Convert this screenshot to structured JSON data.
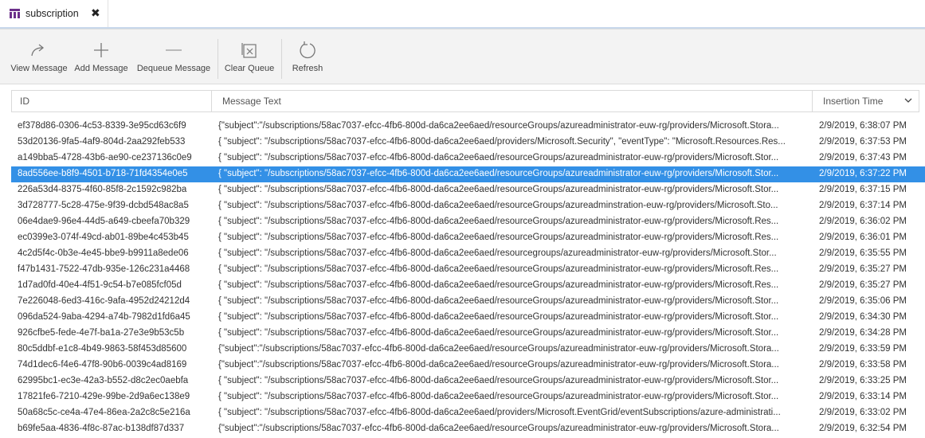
{
  "tab": {
    "title": "subscription",
    "close_glyph": "✖",
    "icon": "queue-icon",
    "icon_color": "#6b2f8a"
  },
  "toolbar": {
    "view_message": "View Message",
    "add_message": "Add Message",
    "dequeue_message": "Dequeue Message",
    "clear_queue": "Clear Queue",
    "refresh": "Refresh"
  },
  "columns": {
    "id": "ID",
    "message_text": "Message Text",
    "insertion_time": "Insertion Time"
  },
  "colors": {
    "selected_row": "#3390e6",
    "toolbar_bg": "#f3f3f3"
  },
  "rows": [
    {
      "id": "ef378d86-0306-4c53-8339-3e95cd63c6f9",
      "message": "{\"subject\":\"/subscriptions/58ac7037-efcc-4fb6-800d-da6ca2ee6aed/resourceGroups/azureadministrator-euw-rg/providers/Microsoft.Stora...",
      "time": "2/9/2019, 6:38:07 PM"
    },
    {
      "id": "53d20136-9fa5-4af9-804d-2aa292feb533",
      "message": "{ \"subject\": \"/subscriptions/58ac7037-efcc-4fb6-800d-da6ca2ee6aed/providers/Microsoft.Security\", \"eventType\": \"Microsoft.Resources.Res...",
      "time": "2/9/2019, 6:37:53 PM"
    },
    {
      "id": "a149bba5-4728-43b6-ae90-ce237136c0e9",
      "message": "{ \"subject\": \"/subscriptions/58ac7037-efcc-4fb6-800d-da6ca2ee6aed/resourceGroups/azureadministrator-euw-rg/providers/Microsoft.Stor...",
      "time": "2/9/2019, 6:37:43 PM"
    },
    {
      "id": "8ad556ee-b8f9-4501-b718-71fd4354e0e5",
      "message": "{ \"subject\": \"/subscriptions/58ac7037-efcc-4fb6-800d-da6ca2ee6aed/resourceGroups/azureadministrator-euw-rg/providers/Microsoft.Stor...",
      "time": "2/9/2019, 6:37:22 PM",
      "selected": true
    },
    {
      "id": "226a53d4-8375-4f60-85f8-2c1592c982ba",
      "message": "{ \"subject\": \"/subscriptions/58ac7037-efcc-4fb6-800d-da6ca2ee6aed/resourceGroups/azureadministrator-euw-rg/providers/Microsoft.Stor...",
      "time": "2/9/2019, 6:37:15 PM"
    },
    {
      "id": "3d728777-5c28-475e-9f39-dcbd548ac8a5",
      "message": "{ \"subject\": \"/subscriptions/58ac7037-efcc-4fb6-800d-da6ca2ee6aed/resourceGroups/azureadminstration-euw-rg/providers/Microsoft.Sto...",
      "time": "2/9/2019, 6:37:14 PM"
    },
    {
      "id": "06e4dae9-96e4-44d5-a649-cbeefa70b329",
      "message": "{ \"subject\": \"/subscriptions/58ac7037-efcc-4fb6-800d-da6ca2ee6aed/resourceGroups/azureadministrator-euw-rg/providers/Microsoft.Res...",
      "time": "2/9/2019, 6:36:02 PM"
    },
    {
      "id": "ec0399e3-074f-49cd-ab01-89be4c453b45",
      "message": "{ \"subject\": \"/subscriptions/58ac7037-efcc-4fb6-800d-da6ca2ee6aed/resourceGroups/azureadministrator-euw-rg/providers/Microsoft.Res...",
      "time": "2/9/2019, 6:36:01 PM"
    },
    {
      "id": "4c2d5f4c-0b3e-4e45-bbe9-b9911a8ede06",
      "message": "{ \"subject\": \"/subscriptions/58ac7037-efcc-4fb6-800d-da6ca2ee6aed/resourcegroups/azureadministrator-euw-rg/providers/Microsoft.Stor...",
      "time": "2/9/2019, 6:35:55 PM"
    },
    {
      "id": "f47b1431-7522-47db-935e-126c231a4468",
      "message": "{ \"subject\": \"/subscriptions/58ac7037-efcc-4fb6-800d-da6ca2ee6aed/resourceGroups/azureadministrator-euw-rg/providers/Microsoft.Res...",
      "time": "2/9/2019, 6:35:27 PM"
    },
    {
      "id": "1d7ad0fd-40e4-4f51-9c54-b7e085fcf05d",
      "message": "{ \"subject\": \"/subscriptions/58ac7037-efcc-4fb6-800d-da6ca2ee6aed/resourceGroups/azureadministrator-euw-rg/providers/Microsoft.Res...",
      "time": "2/9/2019, 6:35:27 PM"
    },
    {
      "id": "7e226048-6ed3-416c-9afa-4952d24212d4",
      "message": "{ \"subject\": \"/subscriptions/58ac7037-efcc-4fb6-800d-da6ca2ee6aed/resourceGroups/azureadministrator-euw-rg/providers/Microsoft.Stor...",
      "time": "2/9/2019, 6:35:06 PM"
    },
    {
      "id": "096da524-9aba-4294-a74b-7982d1fd6a45",
      "message": "{ \"subject\": \"/subscriptions/58ac7037-efcc-4fb6-800d-da6ca2ee6aed/resourceGroups/azureadministrator-euw-rg/providers/Microsoft.Stor...",
      "time": "2/9/2019, 6:34:30 PM"
    },
    {
      "id": "926cfbe5-fede-4e7f-ba1a-27e3e9b53c5b",
      "message": "{ \"subject\": \"/subscriptions/58ac7037-efcc-4fb6-800d-da6ca2ee6aed/resourceGroups/azureadministrator-euw-rg/providers/Microsoft.Stor...",
      "time": "2/9/2019, 6:34:28 PM"
    },
    {
      "id": "80c5ddbf-e1c8-4b49-9863-58f453d85600",
      "message": "{\"subject\":\"/subscriptions/58ac7037-efcc-4fb6-800d-da6ca2ee6aed/resourceGroups/azureadministrator-euw-rg/providers/Microsoft.Stora...",
      "time": "2/9/2019, 6:33:59 PM"
    },
    {
      "id": "74d1dec6-f4e6-47f8-90b6-0039c4ad8169",
      "message": "{\"subject\":\"/subscriptions/58ac7037-efcc-4fb6-800d-da6ca2ee6aed/resourceGroups/azureadministrator-euw-rg/providers/Microsoft.Stora...",
      "time": "2/9/2019, 6:33:58 PM"
    },
    {
      "id": "62995bc1-ec3e-42a3-b552-d8c2ec0aebfa",
      "message": "{ \"subject\": \"/subscriptions/58ac7037-efcc-4fb6-800d-da6ca2ee6aed/resourceGroups/azureadministrator-euw-rg/providers/Microsoft.Stor...",
      "time": "2/9/2019, 6:33:25 PM"
    },
    {
      "id": "17821fe6-7210-429e-99be-2d9a6ec138e9",
      "message": "{ \"subject\": \"/subscriptions/58ac7037-efcc-4fb6-800d-da6ca2ee6aed/resourceGroups/azureadministrator-euw-rg/providers/Microsoft.Stor...",
      "time": "2/9/2019, 6:33:14 PM"
    },
    {
      "id": "50a68c5c-ce4a-47e4-86ea-2a2c8c5e216a",
      "message": "{ \"subject\": \"/subscriptions/58ac7037-efcc-4fb6-800d-da6ca2ee6aed/providers/Microsoft.EventGrid/eventSubscriptions/azure-administrati...",
      "time": "2/9/2019, 6:33:02 PM"
    },
    {
      "id": "b69fe5aa-4836-4f8c-87ac-b138df87d337",
      "message": "{\"subject\":\"/subscriptions/58ac7037-efcc-4fb6-800d-da6ca2ee6aed/resourceGroups/azureadministrator-euw-rg/providers/Microsoft.Stora...",
      "time": "2/9/2019, 6:32:54 PM"
    }
  ]
}
